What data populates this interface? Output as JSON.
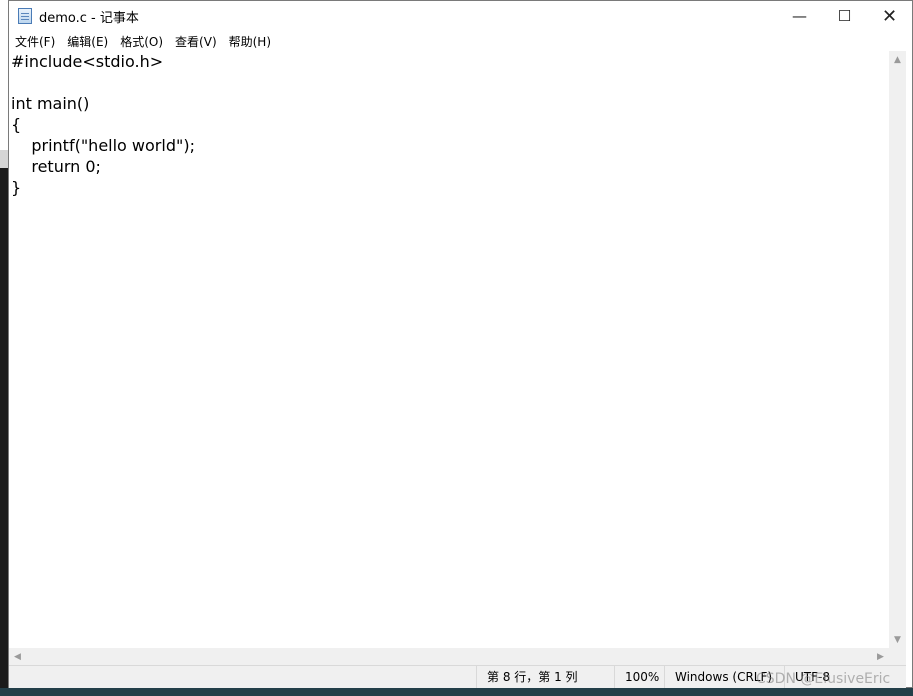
{
  "window": {
    "title": "demo.c - 记事本"
  },
  "title_controls": {
    "minimize": "—",
    "maximize": "☐",
    "close": "✕"
  },
  "menu": {
    "items": [
      "文件(F)",
      "编辑(E)",
      "格式(O)",
      "查看(V)",
      "帮助(H)"
    ]
  },
  "editor": {
    "lines": [
      "#include<stdio.h>",
      "",
      "int main()",
      "{",
      "    printf(\"hello world\");",
      "    return 0;",
      "}"
    ]
  },
  "status": {
    "position": "第 8 行，第 1 列",
    "zoom": "100%",
    "line_ending": "Windows (CRLF)",
    "encoding": "UTF-8"
  },
  "watermark": "CSDN @ElusiveEric",
  "icons": {
    "app": "notepad-icon",
    "scroll_up": "▲",
    "scroll_down": "▼",
    "scroll_left": "◀",
    "scroll_right": "▶"
  }
}
